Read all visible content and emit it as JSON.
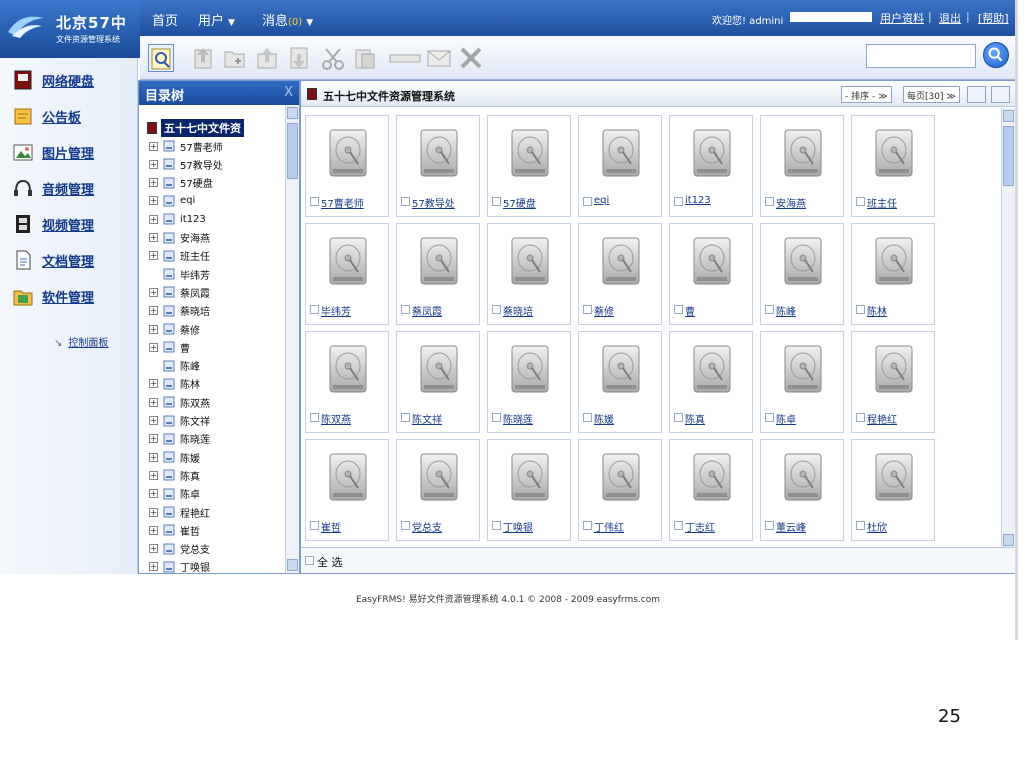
{
  "logo": {
    "name": "北京57中",
    "subtitle": "文件资源管理系统"
  },
  "topnav": {
    "home": "首页",
    "users": "用户",
    "messages": "消息",
    "message_count": "(0)"
  },
  "userbar": {
    "welcome": "欢迎您! admini",
    "profile": "用户资料",
    "logout": "退出",
    "help": "[帮助]",
    "sep": "|"
  },
  "leftnav": {
    "items": [
      {
        "label": "网络硬盘",
        "icon": "disk-icon"
      },
      {
        "label": "公告板",
        "icon": "bulletin-icon"
      },
      {
        "label": "图片管理",
        "icon": "image-icon"
      },
      {
        "label": "音频管理",
        "icon": "headphones-icon"
      },
      {
        "label": "视频管理",
        "icon": "film-icon"
      },
      {
        "label": "文档管理",
        "icon": "document-icon"
      },
      {
        "label": "软件管理",
        "icon": "software-icon"
      }
    ],
    "control_panel": "控制面板"
  },
  "tree": {
    "title": "目录树",
    "close": "X",
    "root": "五十七中文件资",
    "nodes": [
      {
        "label": "57曹老师",
        "expand": "+"
      },
      {
        "label": "57教导处",
        "expand": "+"
      },
      {
        "label": "57硬盘",
        "expand": "+"
      },
      {
        "label": "eqi",
        "expand": "+"
      },
      {
        "label": "it123",
        "expand": "+"
      },
      {
        "label": "安海燕",
        "expand": "+"
      },
      {
        "label": "班主任",
        "expand": "+"
      },
      {
        "label": "毕纬芳",
        "expand": ""
      },
      {
        "label": "蔡凤霞",
        "expand": "+"
      },
      {
        "label": "蔡晓培",
        "expand": "+"
      },
      {
        "label": "蔡修",
        "expand": "+"
      },
      {
        "label": "曹",
        "expand": "+"
      },
      {
        "label": "陈峰",
        "expand": ""
      },
      {
        "label": "陈林",
        "expand": "+"
      },
      {
        "label": "陈双燕",
        "expand": "+"
      },
      {
        "label": "陈文祥",
        "expand": "+"
      },
      {
        "label": "陈晓莲",
        "expand": "+"
      },
      {
        "label": "陈媛",
        "expand": "+"
      },
      {
        "label": "陈真",
        "expand": "+"
      },
      {
        "label": "陈卓",
        "expand": "+"
      },
      {
        "label": "程艳红",
        "expand": "+"
      },
      {
        "label": "崔哲",
        "expand": "+"
      },
      {
        "label": "党总支",
        "expand": "+"
      },
      {
        "label": "丁唤银",
        "expand": "+"
      }
    ]
  },
  "main": {
    "title": "五十七中文件资源管理系统",
    "sort": "- 排序 - ≫",
    "per_page": "每页[30] ≫",
    "select_all": "全 选",
    "folders": [
      "57曹老师",
      "57教导处",
      "57硬盘",
      "eqi",
      "it123",
      "安海燕",
      "班主任",
      "毕纬芳",
      "蔡凤霞",
      "蔡晓培",
      "蔡修",
      "曹",
      "陈峰",
      "陈林",
      "陈双燕",
      "陈文祥",
      "陈晓莲",
      "陈媛",
      "陈真",
      "陈卓",
      "程艳红",
      "崔哲",
      "党总支",
      "丁唤银",
      "丁伟红",
      "丁志红",
      "董云峰",
      "杜欣"
    ]
  },
  "footer": "EasyFRMS! 易好文件资源管理系统 4.0.1 © 2008 - 2009 easyfrms.com",
  "slide_number": "25",
  "colors": {
    "header_blue": "#1f4f9e",
    "link_blue": "#153a8a",
    "selection": "#0a246a"
  }
}
